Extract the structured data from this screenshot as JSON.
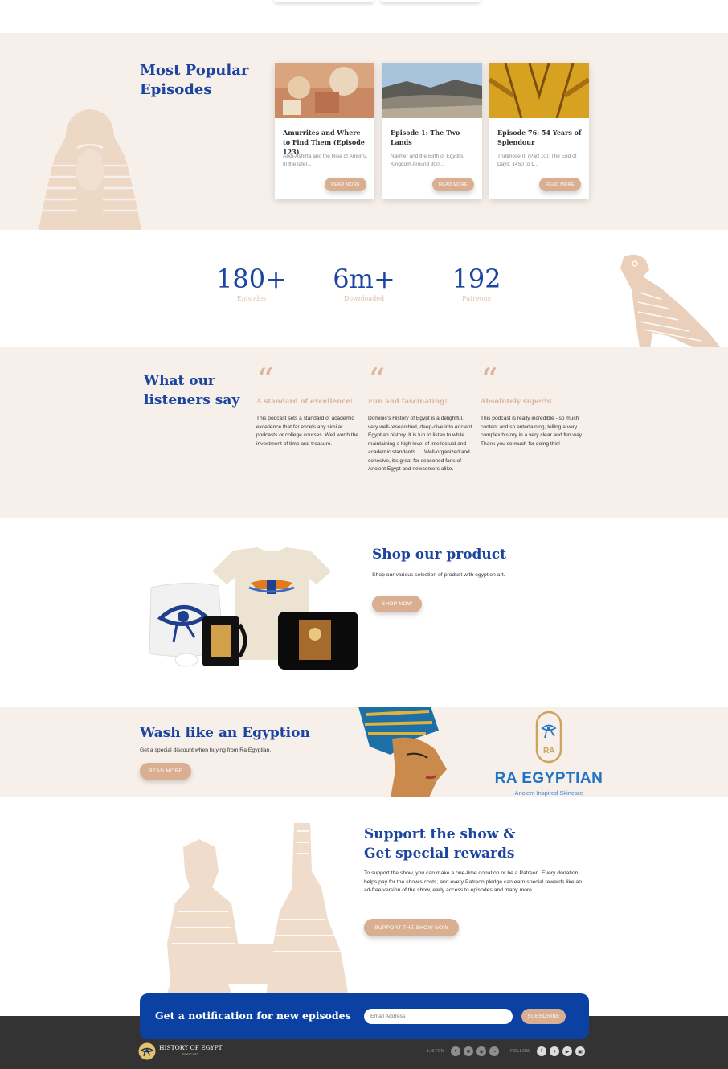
{
  "popular": {
    "title": "Most Popular Episodes",
    "episodes": [
      {
        "title": "Amurrites and Where to Find Them (Episode 123)",
        "desc": "Abdi-Ashirta and the Rise of Amurru. In the later...",
        "button": "READ MORE"
      },
      {
        "title": "Episode 1: The Two Lands",
        "desc": "Narmer and the Birth of Egypt's Kingdom Around 300...",
        "button": "READ MORE"
      },
      {
        "title": "Episode 76: 54 Years of Splendour",
        "desc": "Thutmose III (Part 10): The End of Days: 1450 to 1...",
        "button": "READ MORE"
      }
    ]
  },
  "stats": [
    {
      "value": "180+",
      "label": "Episodes"
    },
    {
      "value": "6m+",
      "label": "Downloaded"
    },
    {
      "value": "192",
      "label": "Patreons"
    }
  ],
  "testimonials": {
    "title": "What our listeners say",
    "items": [
      {
        "quote_mark": "“",
        "heading": "A standard of excellence!",
        "body": "This podcast sets a standard of academic excellence that far excels any similar podcasts or college courses. Well worth the investment of time and treasure."
      },
      {
        "quote_mark": "“",
        "heading": "Fun and fascinating!",
        "body": "Dominic's History of Egypt is a delightful, very well-researched, deep-dive into Ancient Egyptian history. It is fun to listen to while maintaining a high level of intellectual and academic standards. ... Well-organized and cohesive, it's great for seasoned fans of Ancient Egypt and newcomers alike."
      },
      {
        "quote_mark": "“",
        "heading": "Absolutely superb!",
        "body": "This podcast is really incredible - so much content and so entertaining, telling a very complex history in a very clear and fun way. Thank you so much for doing this!"
      }
    ]
  },
  "shop": {
    "title": "Shop our product",
    "subtitle": "Shop our various selection of product with egyption art.",
    "button": "SHOP NOW"
  },
  "wash": {
    "title": "Wash like an Egyption",
    "subtitle": "Get a special discount when buying from Ra Egyptian.",
    "button": "READ MORE",
    "brand_letters": "RA",
    "brand_name": "RA EGYPTIAN",
    "brand_tagline": "Ancient Inspired Skincare"
  },
  "support": {
    "title_line1": "Support the show &",
    "title_line2": "Get special rewards",
    "body": "To support the show, you can make a one-time donation or be a Patreon. Every donation helps pay for the show's costs, and every Patreon pledge can earn special rewards like an ad-free version of the show, early access to episodes and many more.",
    "button": "SUPPORT THE SHOW NOW"
  },
  "newsletter": {
    "title": "Get a notification for new episodes",
    "placeholder": "Email Address",
    "button": "SUBSCRIBE"
  },
  "footer": {
    "logo_text": "HISTORY OF EGYPT",
    "logo_sub": "PODCAST",
    "listen_label": "LISTEN",
    "follow_label": "FOLLOW",
    "listen_icons": [
      "spotify-icon",
      "google-podcasts-icon",
      "apple-podcasts-icon",
      "rss-icon"
    ],
    "follow_icons": [
      "facebook-icon",
      "twitter-icon",
      "youtube-icon",
      "instagram-icon"
    ]
  },
  "colors": {
    "brand_blue": "#1c45a0",
    "accent_tan": "#d9ae91",
    "section_beige": "#f6efea",
    "footer_dark": "#333333"
  }
}
